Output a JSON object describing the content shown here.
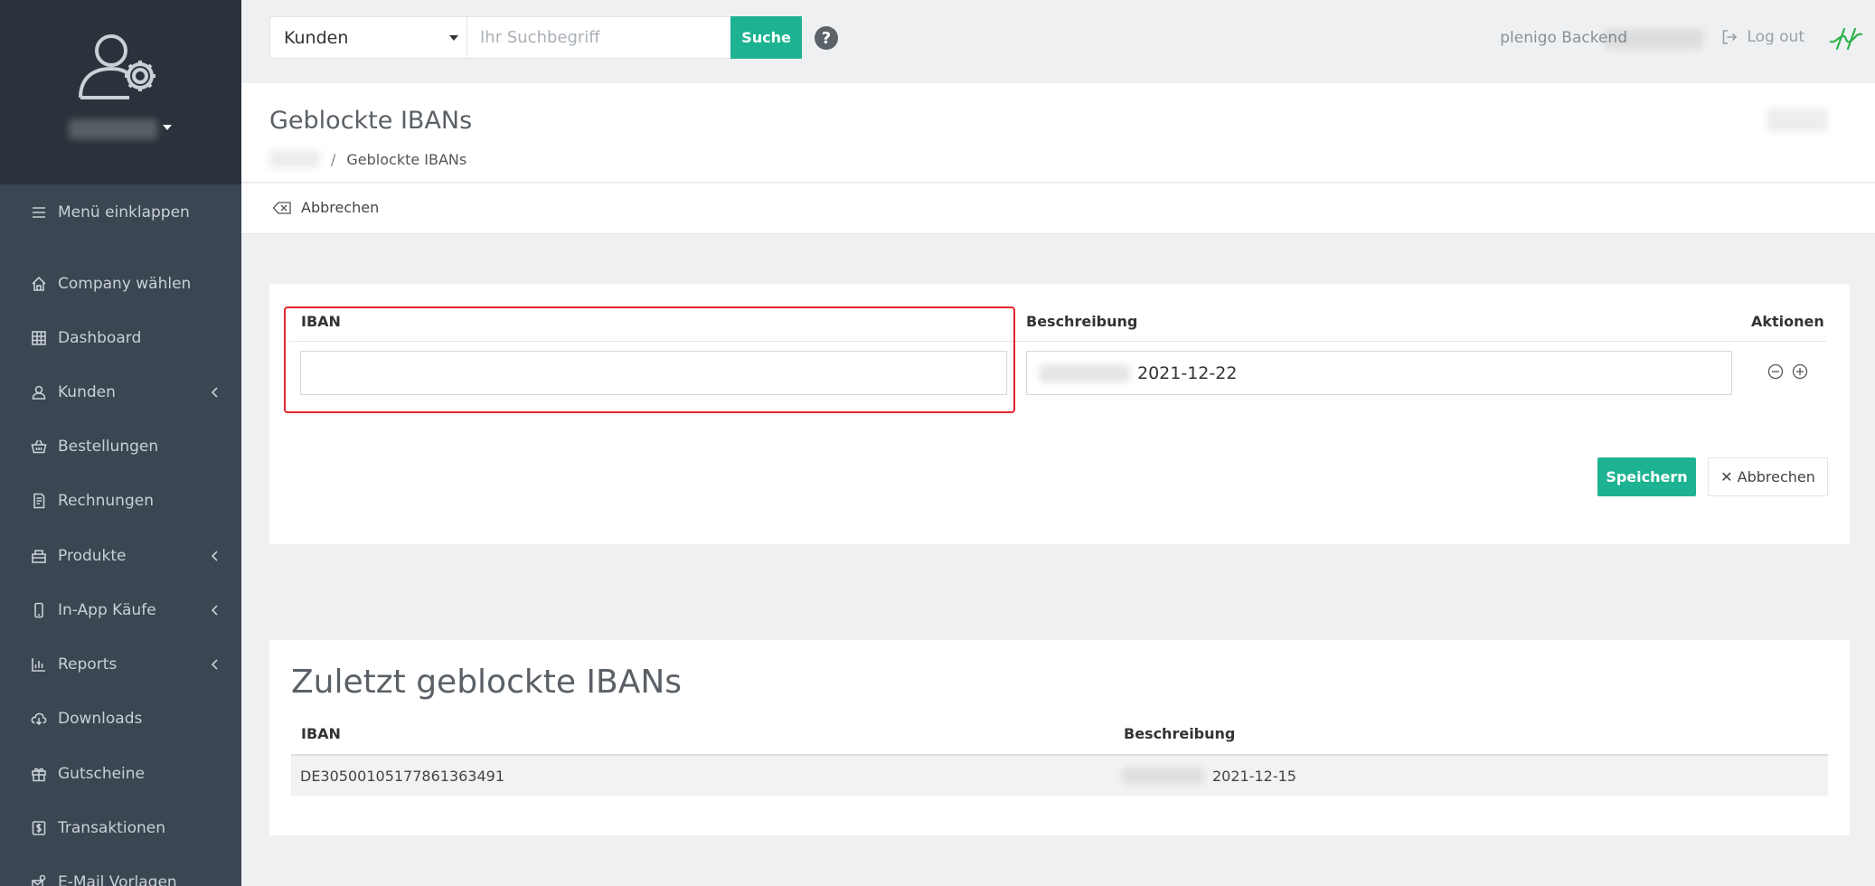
{
  "topbar": {
    "select_value": "Kunden",
    "search_placeholder": "Ihr Suchbegriff",
    "search_button": "Suche",
    "help_symbol": "?",
    "backend_label": "plenigo Backend",
    "logout_label": "Log out"
  },
  "sidebar": {
    "items": [
      {
        "label": "Menü einklappen",
        "icon": "menu-icon"
      },
      {
        "label": "Company wählen",
        "icon": "home-icon"
      },
      {
        "label": "Dashboard",
        "icon": "grid-icon"
      },
      {
        "label": "Kunden",
        "icon": "user-icon"
      },
      {
        "label": "Bestellungen",
        "icon": "basket-icon"
      },
      {
        "label": "Rechnungen",
        "icon": "invoice-icon"
      },
      {
        "label": "Produkte",
        "icon": "products-icon"
      },
      {
        "label": "In-App Käufe",
        "icon": "phone-icon"
      },
      {
        "label": "Reports",
        "icon": "chart-icon"
      },
      {
        "label": "Downloads",
        "icon": "cloud-download-icon"
      },
      {
        "label": "Gutscheine",
        "icon": "gift-icon"
      },
      {
        "label": "Transaktionen",
        "icon": "dollar-icon"
      },
      {
        "label": "E-Mail Vorlagen",
        "icon": "mail-settings-icon"
      }
    ]
  },
  "page": {
    "title": "Geblockte IBANs",
    "breadcrumb_current": "Geblockte IBANs",
    "cancel_label": "Abbrechen"
  },
  "form": {
    "col_iban": "IBAN",
    "col_description": "Beschreibung",
    "col_actions": "Aktionen",
    "iban_value": "",
    "description_value": "2021-12-22",
    "save_label": "Speichern",
    "abort_label": "✕ Abbrechen"
  },
  "recent": {
    "title": "Zuletzt geblockte IBANs",
    "col_iban": "IBAN",
    "col_description": "Beschreibung",
    "rows": [
      {
        "iban": "DE30500105177861363491",
        "description": "2021-12-15"
      }
    ]
  },
  "colors": {
    "accent": "#1db392",
    "sidebar": "#3a4651",
    "sidebar_header": "#2a333b",
    "highlight": "#e0262d"
  }
}
